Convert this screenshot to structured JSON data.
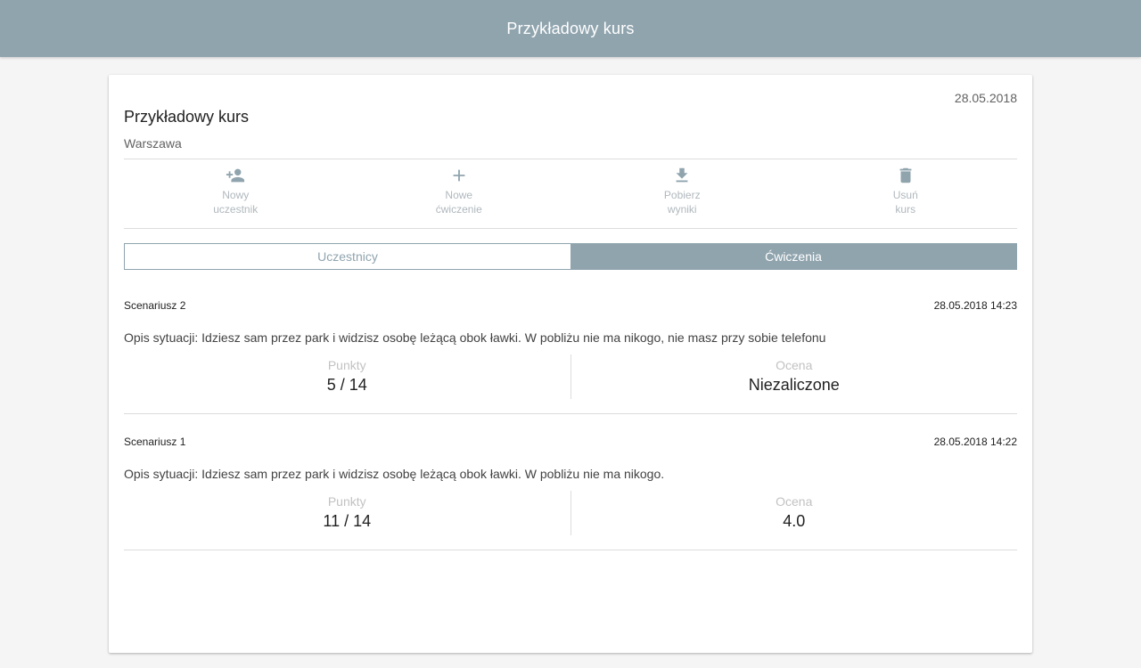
{
  "appbar": {
    "title": "Przykładowy kurs"
  },
  "course": {
    "date": "28.05.2018",
    "title": "Przykładowy kurs",
    "city": "Warszawa"
  },
  "actions": [
    {
      "icon": "add-person-icon",
      "line1": "Nowy",
      "line2": "uczestnik"
    },
    {
      "icon": "plus-icon",
      "line1": "Nowe",
      "line2": "ćwiczenie"
    },
    {
      "icon": "download-icon",
      "line1": "Pobierz",
      "line2": "wyniki"
    },
    {
      "icon": "trash-icon",
      "line1": "Usuń",
      "line2": "kurs"
    }
  ],
  "tabs": [
    {
      "label": "Uczestnicy",
      "active": false
    },
    {
      "label": "Ćwiczenia",
      "active": true
    }
  ],
  "exercises": [
    {
      "name": "Scenariusz 2",
      "datetime": "28.05.2018 14:23",
      "description": "Opis sytuacji: Idziesz sam przez park i widzisz osobę leżącą obok ławki. W pobliżu nie ma nikogo, nie masz przy sobie telefonu",
      "points_label": "Punkty",
      "points_value": "5 / 14",
      "grade_label": "Ocena",
      "grade_value": "Niezaliczone"
    },
    {
      "name": "Scenariusz 1",
      "datetime": "28.05.2018 14:22",
      "description": "Opis sytuacji: Idziesz sam przez park i widzisz osobę leżącą obok ławki. W pobliżu nie ma nikogo.",
      "points_label": "Punkty",
      "points_value": "11 / 14",
      "grade_label": "Ocena",
      "grade_value": "4.0"
    }
  ],
  "colors": {
    "primary": "#90a4ae",
    "icon": "#90a4ae",
    "muted_text": "#b0b8bd"
  }
}
